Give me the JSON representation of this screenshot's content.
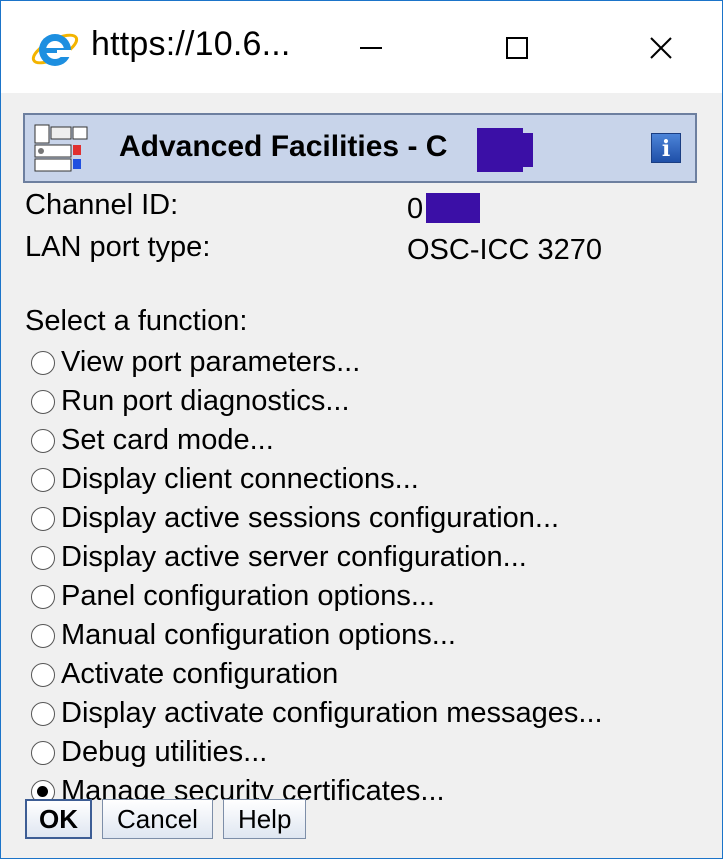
{
  "window": {
    "title": "https://10.6...",
    "browser_icon": "internet-explorer-icon",
    "controls": {
      "minimize": "minimize-icon",
      "maximize": "maximize-icon",
      "close": "close-icon"
    }
  },
  "banner": {
    "title": "Advanced Facilities - C",
    "icon": "hardware-card-icon",
    "info_label": "i"
  },
  "fields": {
    "channel_id_label": "Channel ID:",
    "channel_id_value": "0",
    "lan_port_type_label": "LAN port type:",
    "lan_port_type_value": "OSC-ICC 3270"
  },
  "select_label": "Select a function:",
  "options": [
    {
      "label": "View port parameters...",
      "checked": false
    },
    {
      "label": "Run port diagnostics...",
      "checked": false
    },
    {
      "label": "Set card mode...",
      "checked": false
    },
    {
      "label": "Display client connections...",
      "checked": false
    },
    {
      "label": "Display active sessions configuration...",
      "checked": false
    },
    {
      "label": "Display active server configuration...",
      "checked": false
    },
    {
      "label": "Panel configuration options...",
      "checked": false
    },
    {
      "label": "Manual configuration options...",
      "checked": false
    },
    {
      "label": "Activate configuration",
      "checked": false
    },
    {
      "label": "Display activate configuration messages...",
      "checked": false
    },
    {
      "label": "Debug utilities...",
      "checked": false
    },
    {
      "label": "Manage security certificates...",
      "checked": true
    }
  ],
  "buttons": {
    "ok": "OK",
    "cancel": "Cancel",
    "help": "Help"
  },
  "colors": {
    "window_border": "#1b74c9",
    "banner_bg": "#c8d4ea",
    "redaction": "#3b0fa6"
  }
}
